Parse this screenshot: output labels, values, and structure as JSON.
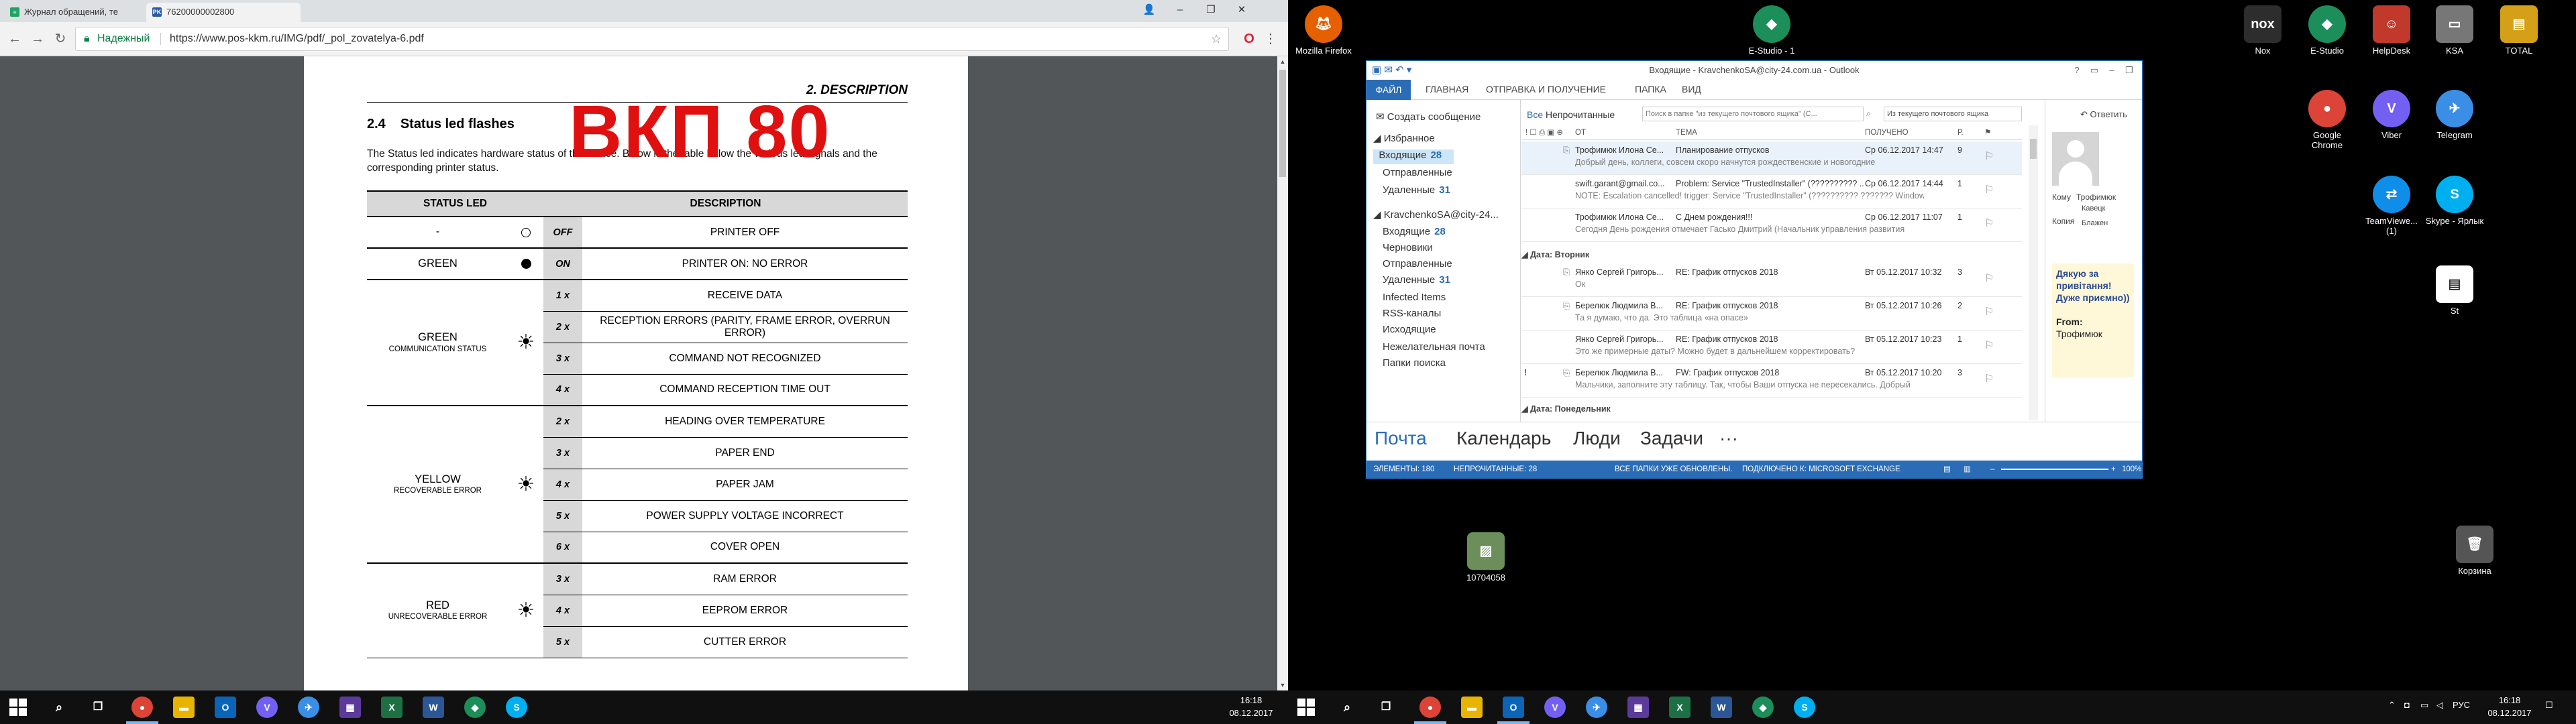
{
  "chrome": {
    "tabs": [
      {
        "label": "Журнал обращений, те",
        "favicon": "green-doc-icon"
      },
      {
        "label": "76200000002800",
        "favicon": "pk-icon"
      }
    ],
    "security_label": "Надежный",
    "url": "https://www.pos-kkm.ru/IMG/pdf/_pol_zovatelya-6.pdf"
  },
  "pdf": {
    "section": "2. DESCRIPTION",
    "title_num": "2.4",
    "title": "Status led flashes",
    "intro": "The Status led indicates hardware status of the device. Below is the table below the various led signals and the corresponding printer status.",
    "stamp": "ВКП 80",
    "headers": {
      "status": "STATUS LED",
      "desc": "DESCRIPTION"
    },
    "rows": {
      "off": {
        "status": "-",
        "code": "OFF",
        "desc": "PRINTER OFF"
      },
      "on": {
        "status": "GREEN",
        "code": "ON",
        "desc": "PRINTER ON: NO ERROR"
      },
      "green_group": {
        "big": "GREEN",
        "small": "COMMUNICATION STATUS"
      },
      "g1": {
        "code": "1 x",
        "desc": "RECEIVE DATA"
      },
      "g2": {
        "code": "2 x",
        "desc": "RECEPTION ERRORS (PARITY, FRAME ERROR, OVERRUN ERROR)"
      },
      "g3": {
        "code": "3 x",
        "desc": "COMMAND NOT RECOGNIZED"
      },
      "g4": {
        "code": "4 x",
        "desc": "COMMAND RECEPTION TIME OUT"
      },
      "yellow_group": {
        "big": "YELLOW",
        "small": "RECOVERABLE ERROR"
      },
      "y2": {
        "code": "2 x",
        "desc": "HEADING OVER TEMPERATURE"
      },
      "y3": {
        "code": "3 x",
        "desc": "PAPER END"
      },
      "y4": {
        "code": "4 x",
        "desc": "PAPER JAM"
      },
      "y5": {
        "code": "5 x",
        "desc": "POWER SUPPLY VOLTAGE INCORRECT"
      },
      "y6": {
        "code": "6 x",
        "desc": "COVER OPEN"
      },
      "red_group": {
        "big": "RED",
        "small": "UNRECOVERABLE ERROR"
      },
      "r3": {
        "code": "3 x",
        "desc": "RAM ERROR"
      },
      "r4": {
        "code": "4 x",
        "desc": "EEPROM ERROR"
      },
      "r5": {
        "code": "5 x",
        "desc": "CUTTER ERROR"
      }
    }
  },
  "taskbar_left": {
    "time": "16:18",
    "date": "08.12.2017"
  },
  "taskbar_right": {
    "time": "16:18",
    "date": "08.12.2017",
    "lang": "РУС"
  },
  "desktop": {
    "firefox": "Mozilla Firefox",
    "estudio": "E-Studio - 1",
    "nox": "Nox",
    "estudio2": "E-Studio",
    "helpdesk": "HelpDesk",
    "ksa": "KSA",
    "total": "TOTAL",
    "chrome": "Google Chrome",
    "viber": "Viber",
    "telegram": "Telegram",
    "teamviewer": "TeamViewe... (1)",
    "skype": "Skype - Ярлык",
    "st": "St",
    "file": "10704058",
    "recycle": "Корзина"
  },
  "outlook": {
    "title": "Входящие - KravchenkoSA@city-24.com.ua - Outlook",
    "ribbon": [
      "ФАЙЛ",
      "ГЛАВНАЯ",
      "ОТПРАВКА И ПОЛУЧЕНИЕ",
      "ПАПКА",
      "ВИД"
    ],
    "new_message": "Создать сообщение",
    "favorites": "Избранное",
    "fav_inbox": "Входящие",
    "fav_inbox_count": "28",
    "fav_sent": "Отправленные",
    "fav_deleted": "Удаленные",
    "fav_deleted_count": "31",
    "account": "KravchenkoSA@city-24...",
    "acc_inbox": "Входящие",
    "acc_inbox_count": "28",
    "drafts": "Черновики",
    "sent": "Отправленные",
    "deleted": "Удаленные",
    "deleted_count": "31",
    "infected": "Infected Items",
    "rss": "RSS-каналы",
    "outbox": "Исходящие",
    "junk": "Нежелательная почта",
    "search_folders": "Папки поиска",
    "filter_all": "Все",
    "filter_unread": "Непрочитанные",
    "search_placeholder": "Поиск в папке \"из текущего почтового ящика\" (С...",
    "search_scope": "Из текущего почтового ящика",
    "cols": {
      "from": "ОТ",
      "subject": "ТЕМА",
      "received": "ПОЛУЧЕНО",
      "size": "Р."
    },
    "msgs": [
      {
        "from": "Трофимюк Илона Се...",
        "subject": "Планирование отпусков",
        "date": "Ср 06.12.2017 14:47",
        "size": "9",
        "preview": "Добрый день, коллеги, совсем скоро начнутся рождественские и новогодние"
      },
      {
        "from": "swift.garant@gmail.co...",
        "subject": "Problem: Service \"TrustedInstaller\" (?????????? ...",
        "date": "Ср 06.12.2017 14:44",
        "size": "1",
        "preview": "NOTE: Escalation cancelled! trigger: Service \"TrustedInstaller\" (?????????? ??????? Windows)"
      },
      {
        "from": "Трофимюк Илона Се...",
        "subject": "С Днем рождения!!!",
        "date": "Ср 06.12.2017 11:07",
        "size": "1",
        "preview": "Сегодня День рождения отмечает Гасько Дмитрий  (Начальник управления развития"
      }
    ],
    "group_tue": "Дата: Вторник",
    "msgs_tue": [
      {
        "from": "Янко Сергей Григорь...",
        "subject": "RE: График отпусков 2018",
        "date": "Вт 05.12.2017 10:32",
        "size": "3",
        "preview": "Ок"
      },
      {
        "from": "Берелюк Людмила В...",
        "subject": "RE: График отпусков 2018",
        "date": "Вт 05.12.2017 10:26",
        "size": "2",
        "preview": "Та я думаю, что да.  Это таблица «на опасе»"
      },
      {
        "from": "Янко Сергей Григорь...",
        "subject": "RE: График отпусков 2018",
        "date": "Вт 05.12.2017 10:23",
        "size": "1",
        "preview": "Это же примерные даты? Можно будет в дальнейшем корректировать?"
      },
      {
        "from": "Берелюк Людмила В...",
        "subject": "FW: График отпусков 2018",
        "date": "Вт 05.12.2017 10:20",
        "size": "3",
        "preview": "Мальчики, заполните эту таблицу.  Так, чтобы Ваши отпуска не пересекались.  Добрый"
      }
    ],
    "group_mon": "Дата: Понедельник",
    "reply": "Ответить",
    "to_label": "Кому",
    "cc_label": "Копия",
    "from_short": "Трофимюк",
    "cc1": "Кавецк",
    "cc2": "Блажен",
    "reading_text": "Дякую за привітання! Дуже приємно))",
    "reading_from_label": "From:",
    "reading_from": "Трофимюк",
    "bottomnav": [
      "Почта",
      "Календарь",
      "Люди",
      "Задачи",
      "···"
    ],
    "status_items": "ЭЛЕМЕНТЫ: 180",
    "status_unread": "НЕПРОЧИТАННЫЕ: 28",
    "status_updated": "ВСЕ ПАПКИ УЖЕ ОБНОВЛЕНЫ.",
    "status_conn": "ПОДКЛЮЧЕНО К: MICROSOFT EXCHANGE",
    "zoom": "100%"
  }
}
